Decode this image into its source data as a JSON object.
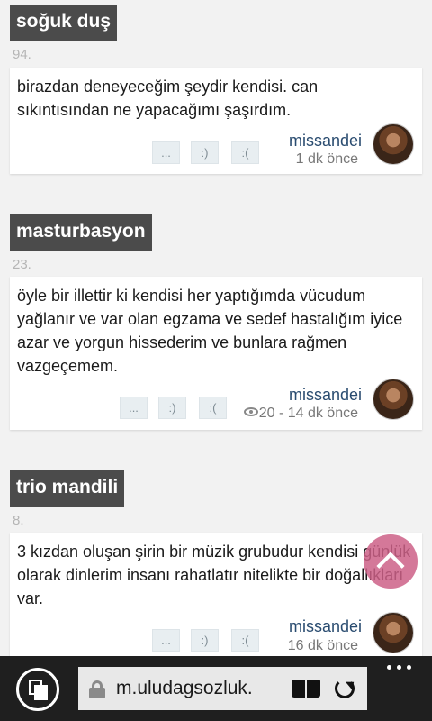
{
  "entries": [
    {
      "title": "soğuk duş",
      "number": "94.",
      "content": "birazdan deneyeceğim şeydir kendisi. can sıkıntısından ne yapacağımı şaşırdım.",
      "votes": [
        "...",
        ":)",
        ":("
      ],
      "author": "missandei",
      "meta": "1 dk önce"
    },
    {
      "title": "masturbasyon",
      "number": "23.",
      "content": "öyle bir illettir ki kendisi her yaptığımda vücudum yağlanır ve var olan egzama ve sedef hastalığım iyice azar ve yorgun hissederim ve bunlara rağmen vazgeçemem.",
      "votes": [
        "...",
        ":)",
        ":("
      ],
      "author": "missandei",
      "views": "20",
      "meta": " - 14 dk önce"
    },
    {
      "title": "trio mandili",
      "number": "8.",
      "content": "3 kızdan oluşan şirin bir müzik grubudur kendisi günlük olarak dinlerim insanı rahatlatır nitelikte bir doğallıkları var.",
      "votes": [
        "...",
        ":)",
        ":("
      ],
      "author": "missandei",
      "meta": "16 dk önce"
    }
  ],
  "browser": {
    "url": "m.uludagsozluk.",
    "more_label": "..."
  },
  "colors": {
    "title_bg": "#4b4b4b",
    "author": "#2a4c70",
    "scroll_top": "#cd6087",
    "bottom_bar": "#1f1f1f"
  }
}
